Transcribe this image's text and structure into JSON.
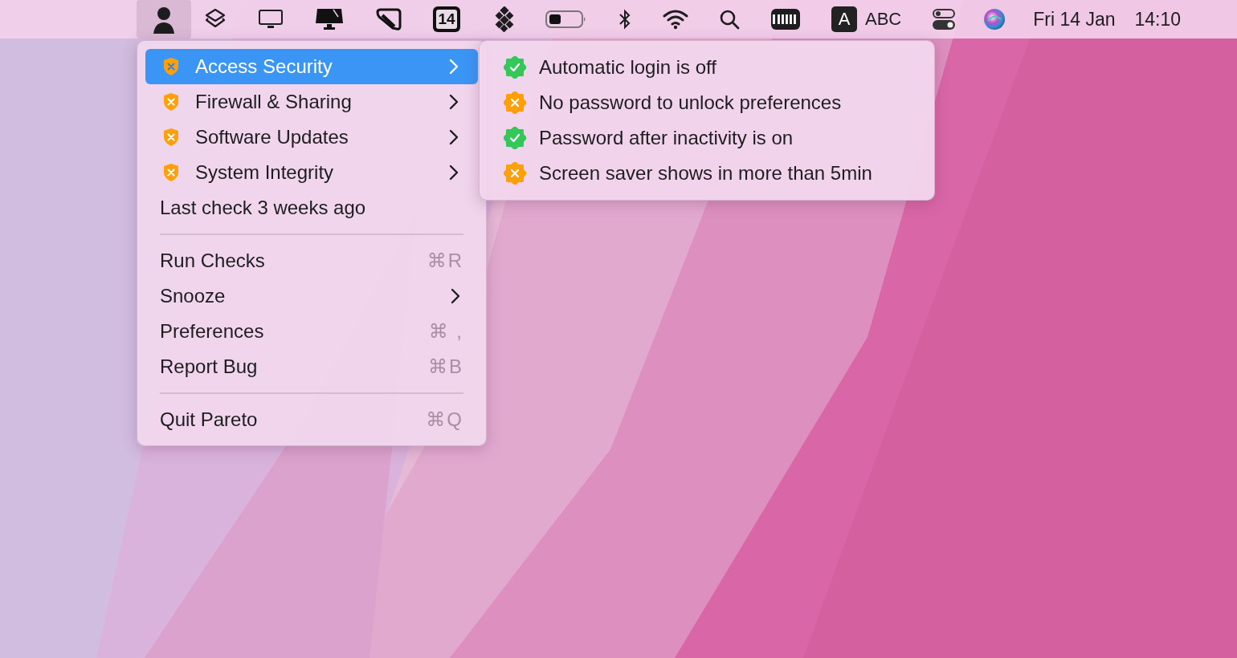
{
  "menu_bar": {
    "app_icon": {
      "selected": true
    },
    "calendar_badge": "14",
    "input_source": {
      "letter": "A",
      "label": "ABC"
    },
    "date": "Fri 14 Jan",
    "time": "14:10"
  },
  "menu": {
    "items": [
      {
        "kind": "check",
        "label": "Access Security",
        "passed": false,
        "submenu": true,
        "selected": true
      },
      {
        "kind": "check",
        "label": "Firewall & Sharing",
        "passed": false,
        "submenu": true,
        "selected": false
      },
      {
        "kind": "check",
        "label": "Software Updates",
        "passed": false,
        "submenu": true,
        "selected": false
      },
      {
        "kind": "check",
        "label": "System Integrity",
        "passed": false,
        "submenu": true,
        "selected": false
      },
      {
        "kind": "info",
        "label": "Last check 3 weeks ago"
      },
      {
        "kind": "separator"
      },
      {
        "kind": "command",
        "label": "Run Checks",
        "shortcut": "⌘R"
      },
      {
        "kind": "command",
        "label": "Snooze",
        "submenu": true
      },
      {
        "kind": "command",
        "label": "Preferences",
        "shortcut": "⌘ ,"
      },
      {
        "kind": "command",
        "label": "Report Bug",
        "shortcut": "⌘B"
      },
      {
        "kind": "separator"
      },
      {
        "kind": "command",
        "label": "Quit Pareto",
        "shortcut": "⌘Q"
      }
    ]
  },
  "submenu": {
    "items": [
      {
        "label": "Automatic login is off",
        "passed": true
      },
      {
        "label": "No password to unlock preferences",
        "passed": false
      },
      {
        "label": "Password after inactivity is on",
        "passed": true
      },
      {
        "label": "Screen saver shows in more than 5min",
        "passed": false
      }
    ]
  }
}
